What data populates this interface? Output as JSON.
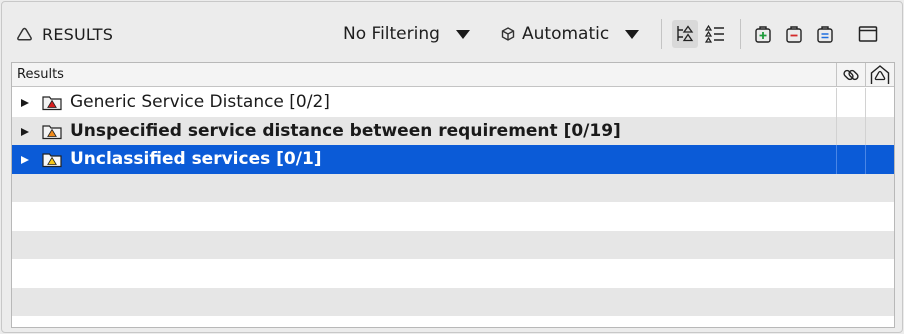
{
  "panel": {
    "title": "RESULTS",
    "title_icon": "triangle-outline-icon"
  },
  "toolbar": {
    "filter_dropdown": {
      "value": "No Filtering",
      "icon": "chevron-down-icon"
    },
    "mode_dropdown": {
      "value": "Automatic",
      "icon": "cube-icon"
    },
    "buttons": [
      {
        "name": "tree-view-icon",
        "active": true
      },
      {
        "name": "ordered-list-icon",
        "active": false
      },
      {
        "name": "add-icon",
        "active": false
      },
      {
        "name": "remove-icon",
        "active": false
      },
      {
        "name": "equals-icon",
        "active": false
      },
      {
        "name": "window-icon",
        "active": false
      }
    ]
  },
  "table": {
    "columns": [
      {
        "label": "Results"
      },
      {
        "icon": "link-icon"
      },
      {
        "icon": "house-warning-icon"
      }
    ],
    "rows": [
      {
        "label": "Generic Service Distance [0/2]",
        "bold": false,
        "severity_color": "#d91e1e",
        "selected": false
      },
      {
        "label": "Unspecified service distance between requirement [0/19]",
        "bold": true,
        "severity_color": "#f08a1a",
        "selected": false
      },
      {
        "label": "Unclassified services [0/1]",
        "bold": true,
        "severity_color": "#f5c518",
        "selected": true
      }
    ]
  },
  "colors": {
    "selection": "#0b5bd7",
    "alt_row": "#e6e6e6",
    "background": "#ececec"
  }
}
